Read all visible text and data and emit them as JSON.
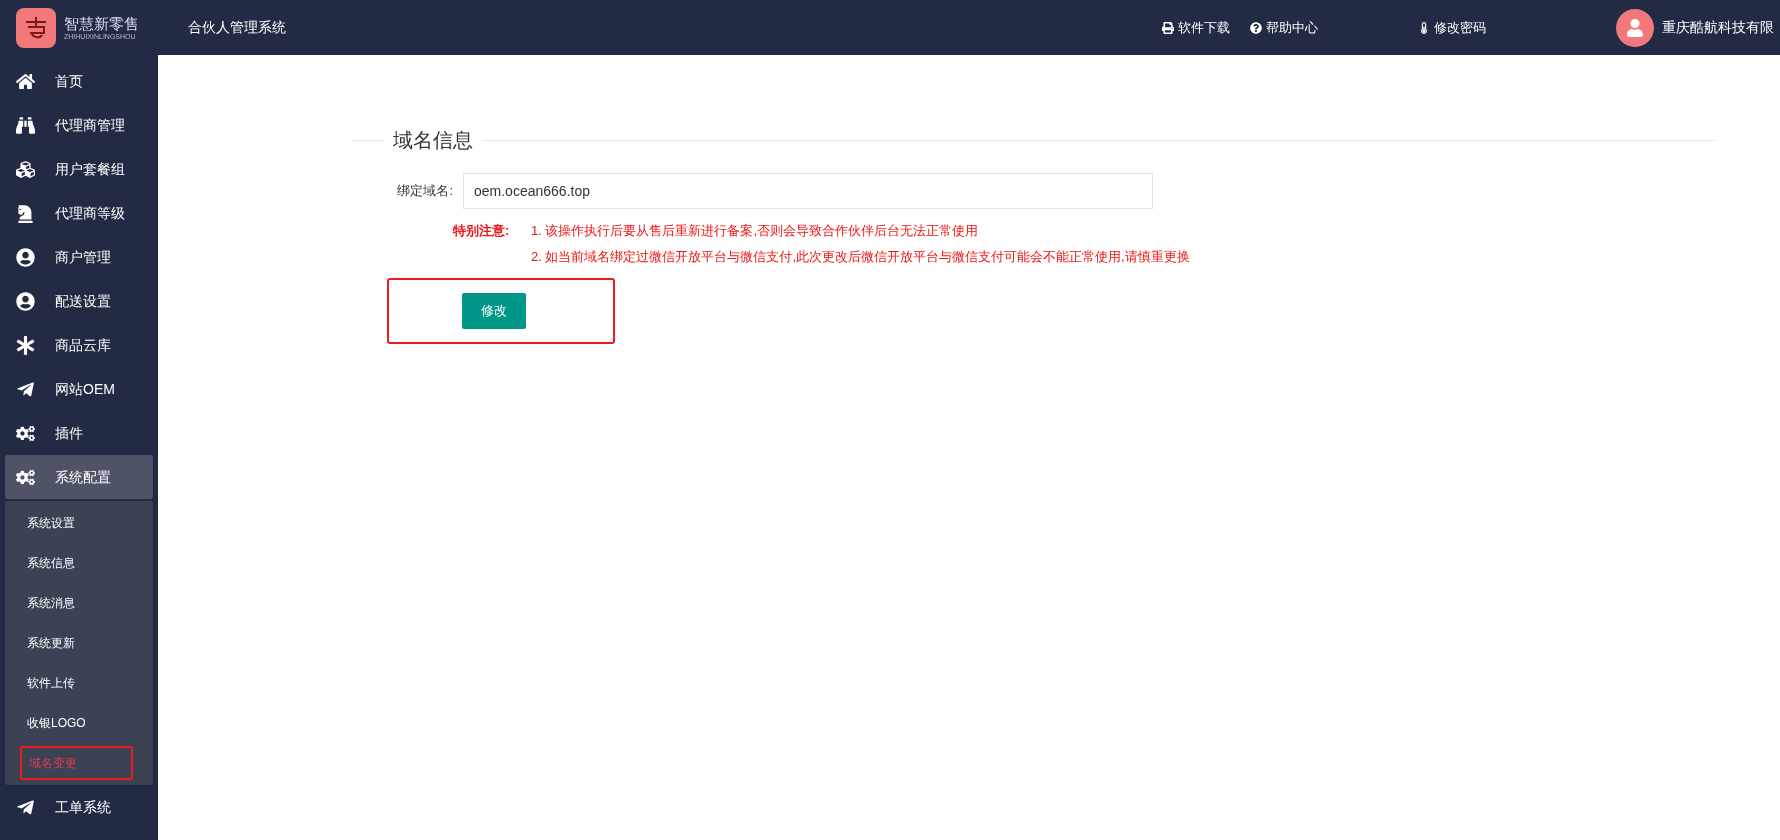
{
  "brand": {
    "name": "智慧新零售",
    "subtitle": "ZHIHUIXINLINGSHOU"
  },
  "header": {
    "title": "合伙人管理系统",
    "links": [
      "软件下载",
      "帮助中心",
      "修改密码"
    ],
    "user": "重庆酷航科技有限"
  },
  "sidebar": {
    "items": [
      {
        "label": "首页",
        "expanded": false
      },
      {
        "label": "代理商管理",
        "expanded": false
      },
      {
        "label": "用户套餐组",
        "expanded": false
      },
      {
        "label": "代理商等级",
        "expanded": false
      },
      {
        "label": "商户管理",
        "expanded": false
      },
      {
        "label": "配送设置",
        "expanded": false
      },
      {
        "label": "商品云库",
        "expanded": false
      },
      {
        "label": "网站OEM",
        "expanded": false
      },
      {
        "label": "插件",
        "expanded": false
      },
      {
        "label": "系统配置",
        "expanded": true,
        "children": [
          {
            "label": "系统设置",
            "selected": false
          },
          {
            "label": "系统信息",
            "selected": false
          },
          {
            "label": "系统消息",
            "selected": false
          },
          {
            "label": "系统更新",
            "selected": false
          },
          {
            "label": "软件上传",
            "selected": false
          },
          {
            "label": "收银LOGO",
            "selected": false
          },
          {
            "label": "域名变更",
            "selected": true
          }
        ]
      },
      {
        "label": "工单系统",
        "expanded": false
      }
    ]
  },
  "section": {
    "title": "域名信息",
    "field": {
      "label": "绑定域名:",
      "value": "oem.ocean666.top"
    },
    "notice": {
      "label": "特别注意:",
      "lines": [
        "1. 该操作执行后要从售后重新进行备案,否则会导致合作伙伴后台无法正常使用",
        "2. 如当前域名绑定过微信开放平台与微信支付,此次更改后微信开放平台与微信支付可能会不能正常使用,请慎重更换"
      ]
    },
    "button": "修改"
  }
}
